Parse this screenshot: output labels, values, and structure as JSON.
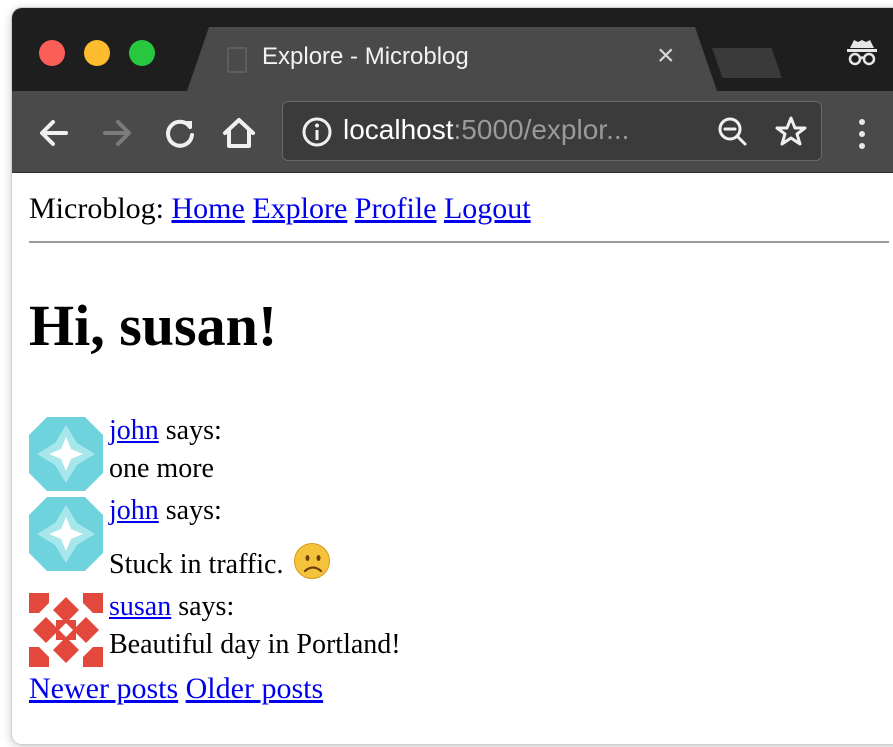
{
  "browser": {
    "tab_title": "Explore - Microblog",
    "tab_close": "×",
    "url_host": "localhost",
    "url_rest": ":5000/explor...",
    "icons": {
      "back": "back-arrow-icon",
      "forward": "forward-arrow-icon",
      "reload": "reload-icon",
      "home": "home-icon",
      "info": "info-icon",
      "zoom": "zoom-out-icon",
      "bookmark": "star-icon",
      "menu": "kebab-menu-icon",
      "incognito": "incognito-icon"
    },
    "colors": {
      "titlebar": "#1e1e1e",
      "toolbar": "#4a4a4a",
      "close": "#fc5f57",
      "minimize": "#fdbc2e",
      "maximize": "#27c840"
    }
  },
  "page": {
    "nav_prefix": "Microblog:",
    "nav_links": [
      "Home",
      "Explore",
      "Profile",
      "Logout"
    ],
    "greeting": "Hi, susan!",
    "posts": [
      {
        "author": "john",
        "says": "says:",
        "body": "one more",
        "avatar": "identicon-teal"
      },
      {
        "author": "john",
        "says": "says:",
        "body": "Stuck in traffic.",
        "emoji": "frowning-face-icon",
        "avatar": "identicon-teal"
      },
      {
        "author": "susan",
        "says": "says:",
        "body": "Beautiful day in Portland!",
        "avatar": "identicon-red"
      }
    ],
    "pager": {
      "newer": "Newer posts",
      "older": "Older posts"
    },
    "colors": {
      "link": "#0000ee",
      "avatar_teal": "#6ed3dc",
      "avatar_red": "#e2483b"
    }
  }
}
